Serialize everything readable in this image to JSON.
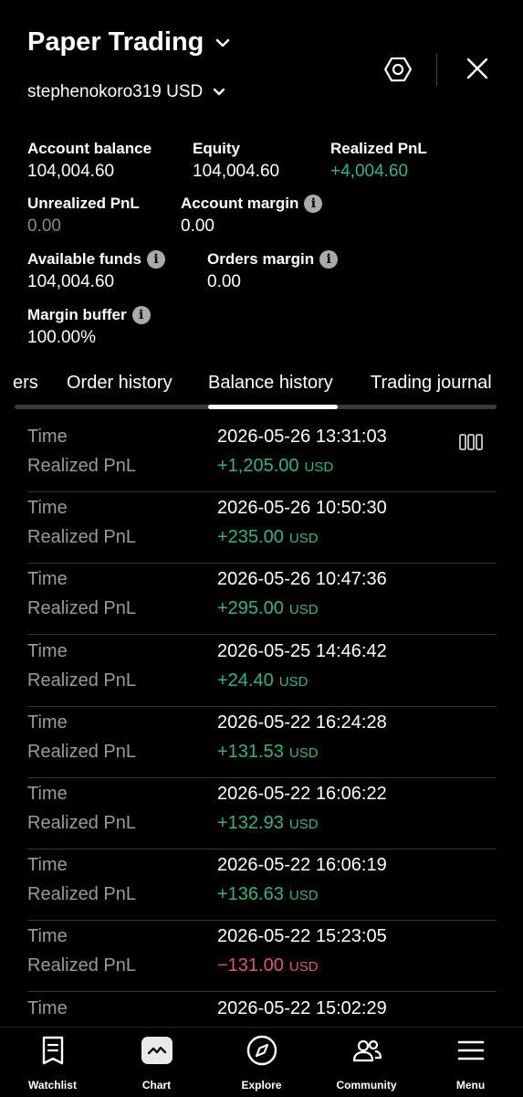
{
  "header": {
    "title": "Paper Trading",
    "account": "stephenokoro319 USD"
  },
  "stats": {
    "account_balance": {
      "label": "Account balance",
      "value": "104,004.60"
    },
    "equity": {
      "label": "Equity",
      "value": "104,004.60"
    },
    "realized_pnl": {
      "label": "Realized PnL",
      "value": "+4,004.60"
    },
    "unrealized_pnl": {
      "label": "Unrealized PnL",
      "value": "0.00"
    },
    "account_margin": {
      "label": "Account margin",
      "value": "0.00"
    },
    "available_funds": {
      "label": "Available funds",
      "value": "104,004.60"
    },
    "orders_margin": {
      "label": "Orders margin",
      "value": "0.00"
    },
    "margin_buffer": {
      "label": "Margin buffer",
      "value": "100.00%"
    }
  },
  "tabs": {
    "partial": "ers",
    "order_history": "Order history",
    "balance_history": "Balance history",
    "trading_journal": "Trading journal",
    "active": "Balance history"
  },
  "history": {
    "time_label": "Time",
    "pnl_label": "Realized PnL",
    "currency": "USD",
    "rows": [
      {
        "time": "2026-05-26 13:31:03",
        "amount": "+1,205.00"
      },
      {
        "time": "2026-05-26 10:50:30",
        "amount": "+235.00"
      },
      {
        "time": "2026-05-26 10:47:36",
        "amount": "+295.00"
      },
      {
        "time": "2026-05-25 14:46:42",
        "amount": "+24.40"
      },
      {
        "time": "2026-05-22 16:24:28",
        "amount": "+131.53"
      },
      {
        "time": "2026-05-22 16:06:22",
        "amount": "+132.93"
      },
      {
        "time": "2026-05-22 16:06:19",
        "amount": "+136.63"
      },
      {
        "time": "2026-05-22 15:23:05",
        "amount": "−131.00"
      },
      {
        "time": "2026-05-22 15:02:29",
        "amount": ""
      }
    ]
  },
  "nav": {
    "watchlist": "Watchlist",
    "chart": "Chart",
    "explore": "Explore",
    "community": "Community",
    "menu": "Menu"
  },
  "colors": {
    "positive": "#2fb38a",
    "negative": "#e05a5a",
    "background": "#000000"
  }
}
